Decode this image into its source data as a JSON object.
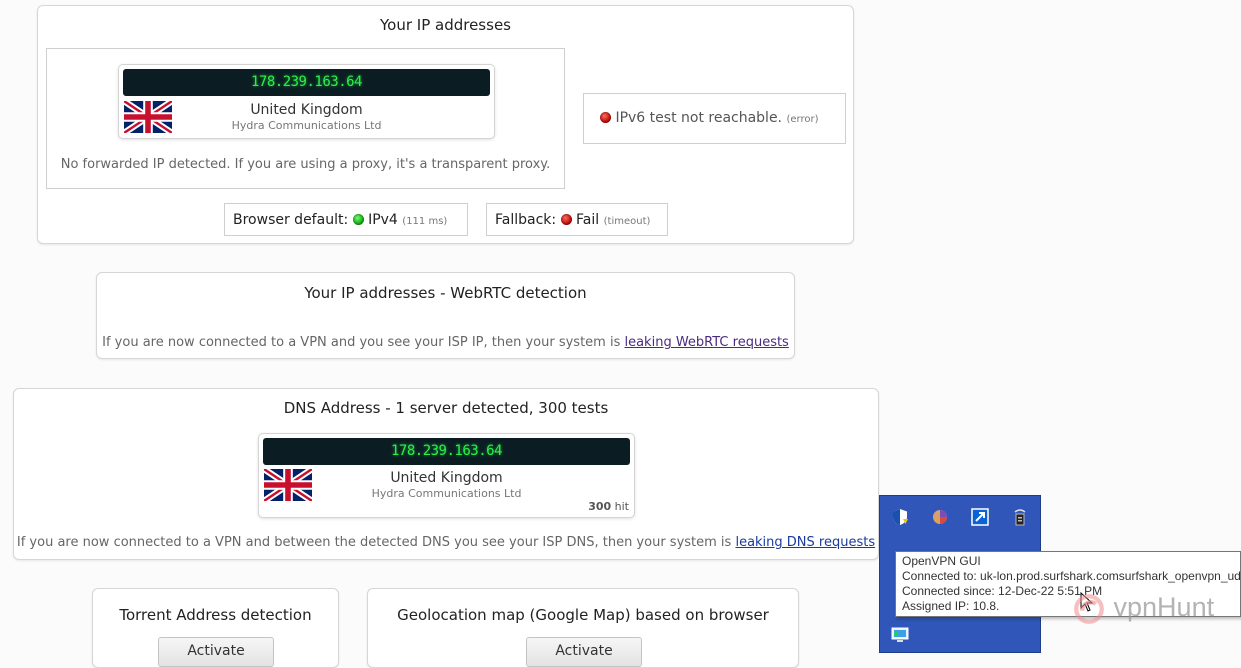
{
  "ip_panel": {
    "title": "Your IP addresses",
    "ip": "178.239.163.64",
    "country": "United Kingdom",
    "isp": "Hydra Communications Ltd",
    "forward_note": "No forwarded IP detected. If you are using a proxy, it's a transparent proxy.",
    "ipv6_text": "IPv6 test not reachable.",
    "ipv6_status": "(error)",
    "browser_default_label": "Browser default:",
    "browser_default_value": "IPv4",
    "browser_default_time": "(111 ms)",
    "fallback_label": "Fallback:",
    "fallback_value": "Fail",
    "fallback_status": "(timeout)"
  },
  "webrtc_panel": {
    "title": "Your IP addresses - WebRTC detection",
    "note_text": "If you are now connected to a VPN and you see your ISP IP, then your system is ",
    "note_link": "leaking WebRTC requests"
  },
  "dns_panel": {
    "title": "DNS Address - 1 server detected, 300 tests",
    "ip": "178.239.163.64",
    "country": "United Kingdom",
    "isp": "Hydra Communications Ltd",
    "hits_count": "300",
    "hits_label": "hit",
    "note_text": "If you are now connected to a VPN and between the detected DNS you see your ISP DNS, then your system is ",
    "note_link": "leaking DNS requests"
  },
  "torrent_panel": {
    "title": "Torrent Address detection",
    "button": "Activate"
  },
  "geo_panel": {
    "title": "Geolocation map (Google Map) based on browser",
    "button": "Activate"
  },
  "tooltip": {
    "line1": "OpenVPN GUI",
    "line2": "Connected to: uk-lon.prod.surfshark.comsurfshark_openvpn_udp",
    "line3": "Connected since: 12-Dec-22 5:51 PM",
    "line4": "Assigned IP: 10.8."
  },
  "watermark": "vpnHunt",
  "colors": {
    "ip_display_bg": "#0b1d22",
    "ip_display_text": "#2cf04a",
    "tray_bg": "#2f56b8",
    "status_ok": "#0a9a0a",
    "status_error": "#b10000"
  }
}
